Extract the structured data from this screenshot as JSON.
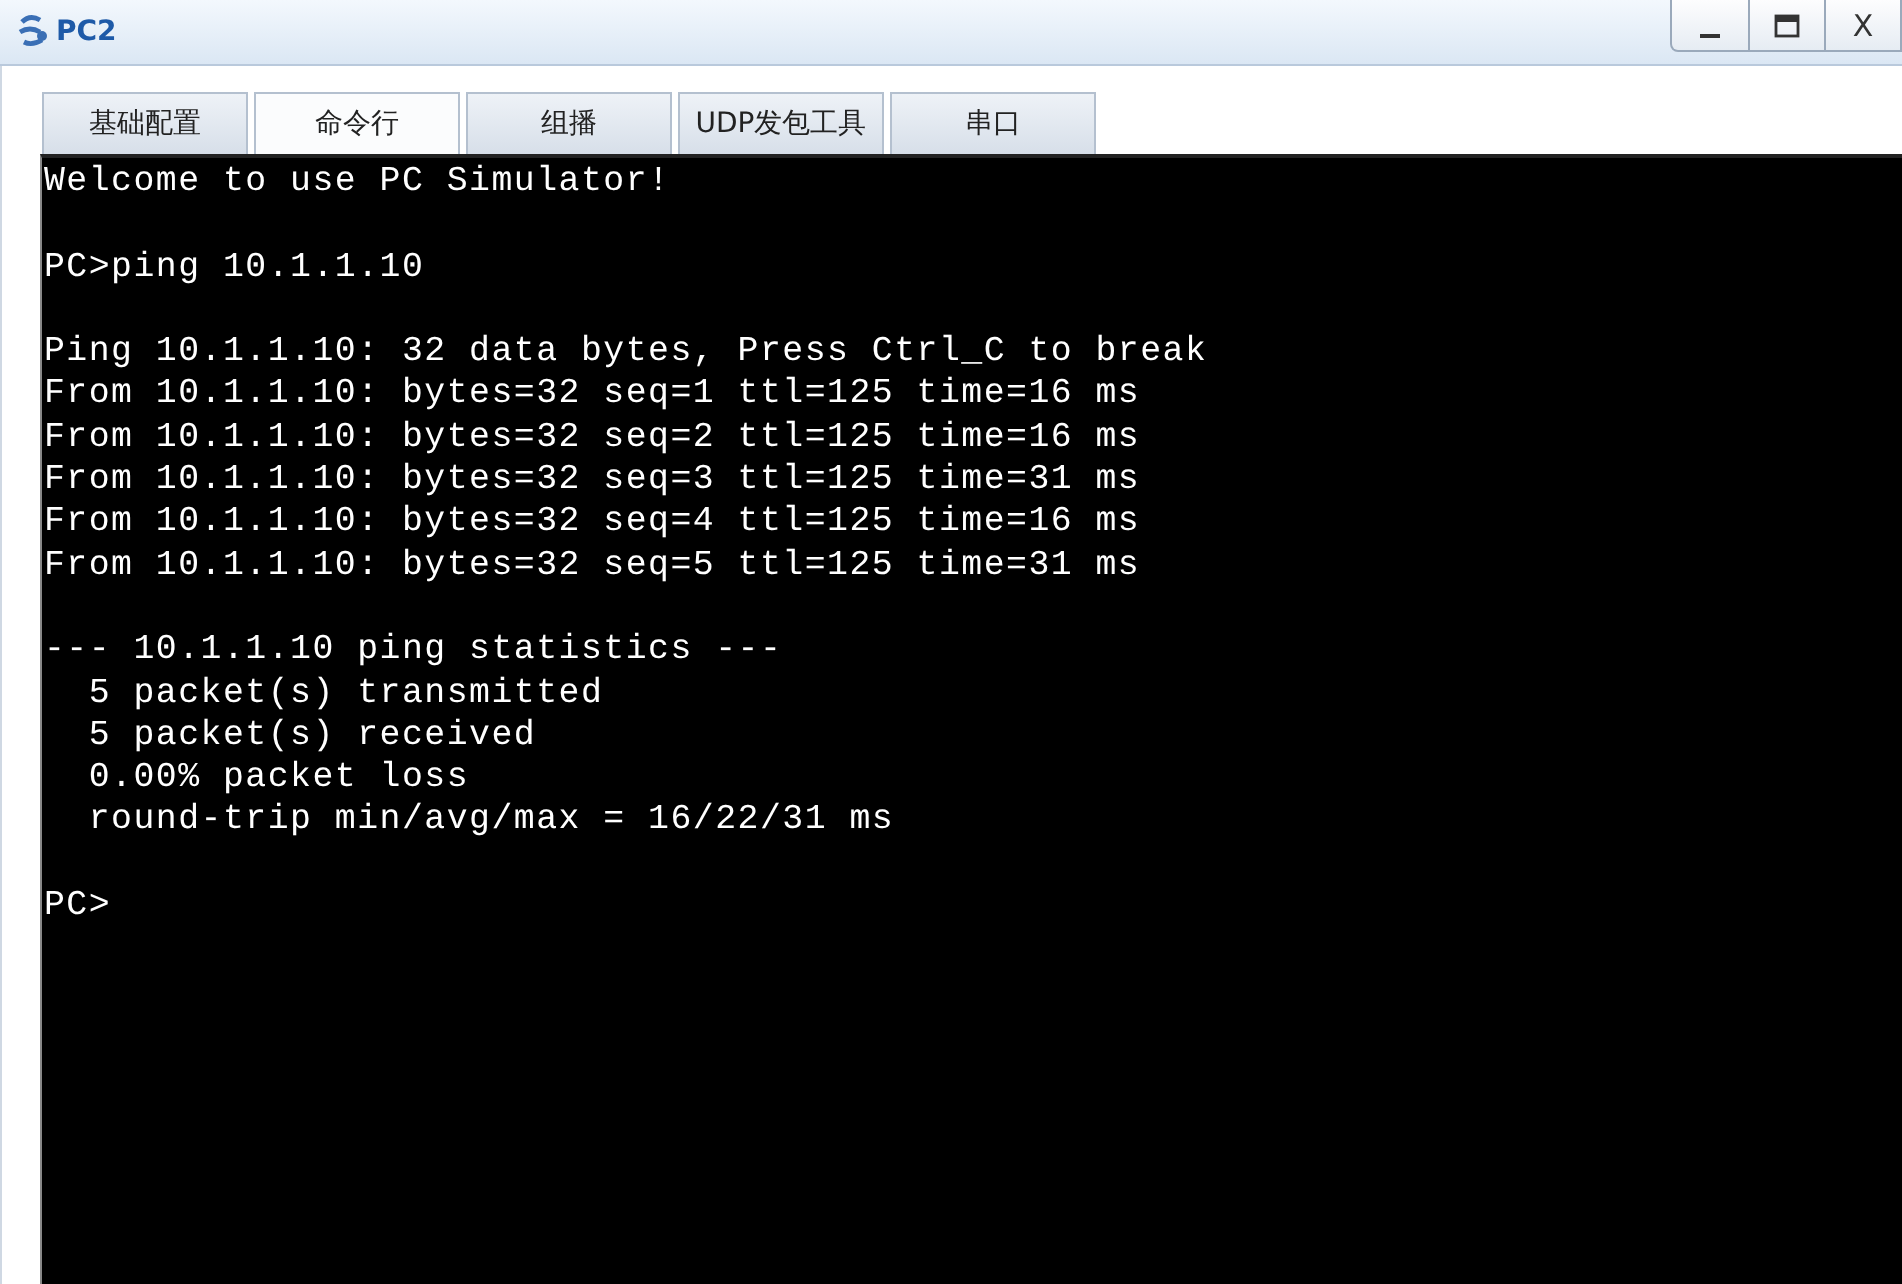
{
  "window": {
    "title": "PC2",
    "close_label": "X"
  },
  "tabs": [
    {
      "label": "基础配置",
      "selected": false
    },
    {
      "label": "命令行",
      "selected": true
    },
    {
      "label": "组播",
      "selected": false
    },
    {
      "label": "UDP发包工具",
      "selected": false
    },
    {
      "label": "串口",
      "selected": false
    }
  ],
  "terminal": {
    "blocks": [
      [
        "Welcome to use PC Simulator!"
      ],
      [
        "PC>ping 10.1.1.10"
      ],
      [
        "Ping 10.1.1.10: 32 data bytes, Press Ctrl_C to break",
        "From 10.1.1.10: bytes=32 seq=1 ttl=125 time=16 ms",
        "From 10.1.1.10: bytes=32 seq=2 ttl=125 time=16 ms",
        "From 10.1.1.10: bytes=32 seq=3 ttl=125 time=31 ms",
        "From 10.1.1.10: bytes=32 seq=4 ttl=125 time=16 ms",
        "From 10.1.1.10: bytes=32 seq=5 ttl=125 time=31 ms"
      ],
      [
        "--- 10.1.1.10 ping statistics ---",
        "  5 packet(s) transmitted",
        "  5 packet(s) received",
        "  0.00% packet loss",
        "  round-trip min/avg/max = 16/22/31 ms"
      ],
      [
        "PC>"
      ]
    ]
  }
}
